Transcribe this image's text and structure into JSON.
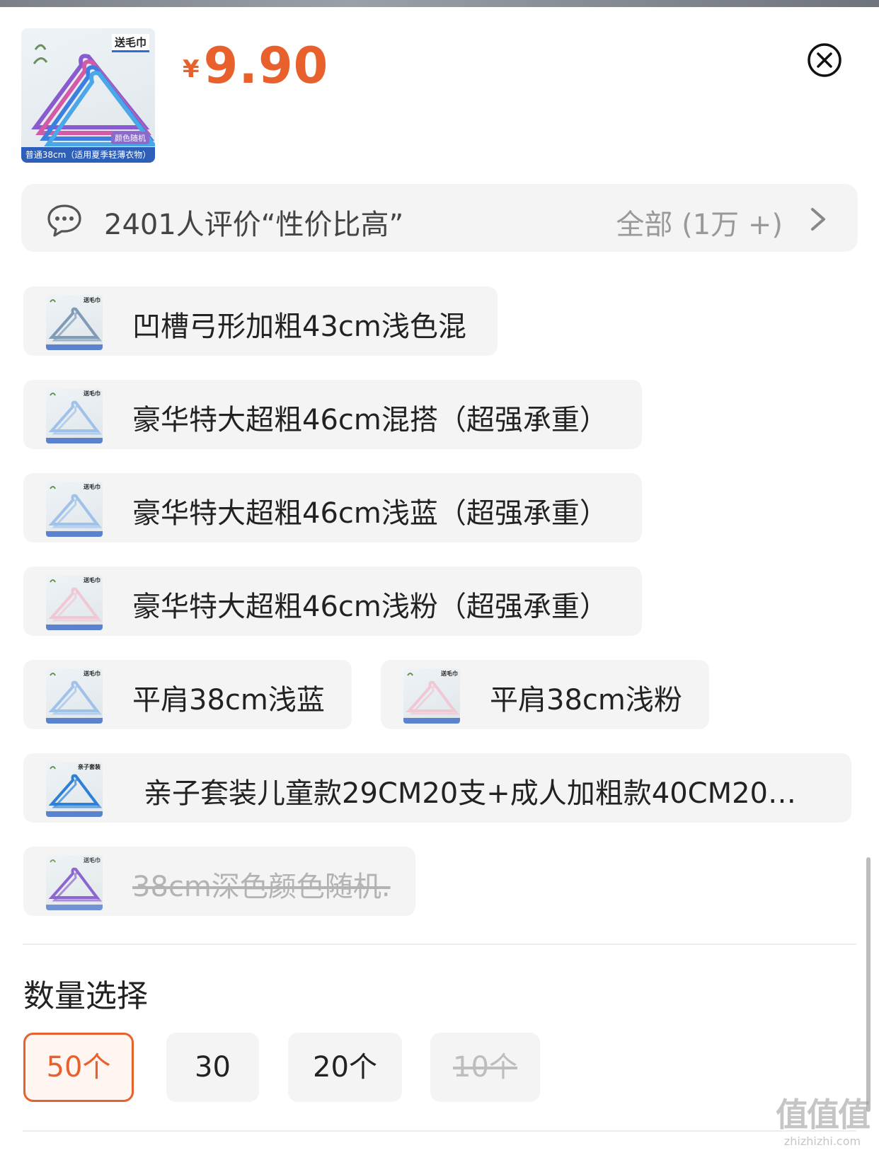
{
  "product": {
    "image_tag": "送毛巾",
    "image_badge": "颜色随机",
    "image_footer": "普通38cm（适用夏季轻薄衣物）",
    "currency": "¥",
    "price": "9.90"
  },
  "review": {
    "text": "2401人评价“性价比高”",
    "all_label": "全部 (1万 +)"
  },
  "variants": [
    {
      "label": "凹槽弓形加粗43cm浅色混",
      "thumb_tag": "送毛巾",
      "accent": "#7f9bb8"
    },
    {
      "label": "豪华特大超粗46cm混搭（超强承重）",
      "thumb_tag": "送毛巾",
      "accent": "#9fc2ea"
    },
    {
      "label": "豪华特大超粗46cm浅蓝（超强承重）",
      "thumb_tag": "送毛巾",
      "accent": "#9fc2ea"
    },
    {
      "label": "豪华特大超粗46cm浅粉（超强承重）",
      "thumb_tag": "送毛巾",
      "accent": "#f0c8d4"
    },
    {
      "label": "平肩38cm浅蓝",
      "thumb_tag": "送毛巾",
      "accent": "#9fc2ea"
    },
    {
      "label": "平肩38cm浅粉",
      "thumb_tag": "送毛巾",
      "accent": "#f0c8d4"
    },
    {
      "label": "亲子套装儿童款29CM20支+成人加粗款40CM20…",
      "thumb_tag": "亲子套装",
      "accent": "#2d7fd8"
    },
    {
      "label": "38cm深色颜色随机.",
      "thumb_tag": "送毛巾",
      "accent": "#7a4fc9",
      "disabled": true
    }
  ],
  "quantity": {
    "title": "数量选择",
    "options": [
      {
        "label": "50个",
        "selected": true
      },
      {
        "label": "30"
      },
      {
        "label": "20个"
      },
      {
        "label": "10个",
        "disabled": true
      }
    ]
  },
  "watermark": {
    "logo": "值值值",
    "url": "zhizhizhi.com"
  },
  "colors": {
    "accent": "#e8602c",
    "chip_bg": "#f4f4f4",
    "disabled_text": "#b3b3b3"
  }
}
